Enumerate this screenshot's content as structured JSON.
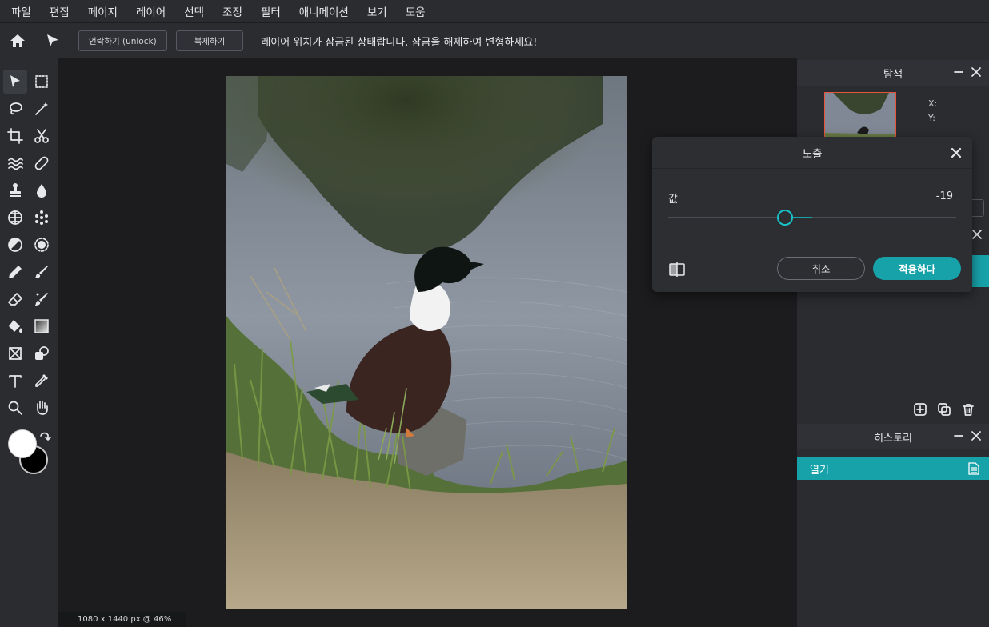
{
  "menu": [
    "파일",
    "편집",
    "페이지",
    "레이어",
    "선택",
    "조정",
    "필터",
    "애니메이션",
    "보기",
    "도움"
  ],
  "toolbar": {
    "unlock_label": "언락하기 (unlock)",
    "duplicate_label": "복제하기",
    "lock_message": "레이어 위치가 잠금된 상태랍니다. 잠금을 해제하여 변형하세요!"
  },
  "tools": [
    {
      "name": "select-arrow-icon",
      "active": true
    },
    {
      "name": "marquee-select-icon"
    },
    {
      "name": "lasso-icon"
    },
    {
      "name": "magic-wand-icon"
    },
    {
      "name": "crop-icon"
    },
    {
      "name": "scissors-icon"
    },
    {
      "name": "liquify-icon"
    },
    {
      "name": "bandage-icon"
    },
    {
      "name": "stamp-icon"
    },
    {
      "name": "drop-icon"
    },
    {
      "name": "sponge-icon"
    },
    {
      "name": "blur-dots-icon"
    },
    {
      "name": "dodge-burn-icon"
    },
    {
      "name": "sharpen-icon"
    },
    {
      "name": "pencil-icon"
    },
    {
      "name": "brush-icon"
    },
    {
      "name": "eraser-icon"
    },
    {
      "name": "smudge-brush-icon"
    },
    {
      "name": "paint-bucket-icon"
    },
    {
      "name": "gradient-icon"
    },
    {
      "name": "shape-icon"
    },
    {
      "name": "replace-color-icon"
    },
    {
      "name": "text-icon"
    },
    {
      "name": "eyedropper-icon"
    },
    {
      "name": "zoom-icon"
    },
    {
      "name": "hand-icon"
    }
  ],
  "colors": {
    "foreground": "#ffffff",
    "background": "#000000",
    "accent": "#17a2a9"
  },
  "status": "1080 x 1440 px @ 46%",
  "navigator": {
    "title": "탐색",
    "x_label": "X:",
    "y_label": "Y:"
  },
  "history": {
    "title": "히스토리",
    "items": [
      "열기"
    ]
  },
  "dialog": {
    "title": "노출",
    "label": "값",
    "value": "-19",
    "min": -100,
    "max": 100,
    "current": -19,
    "cancel_label": "취소",
    "apply_label": "적용하다"
  }
}
